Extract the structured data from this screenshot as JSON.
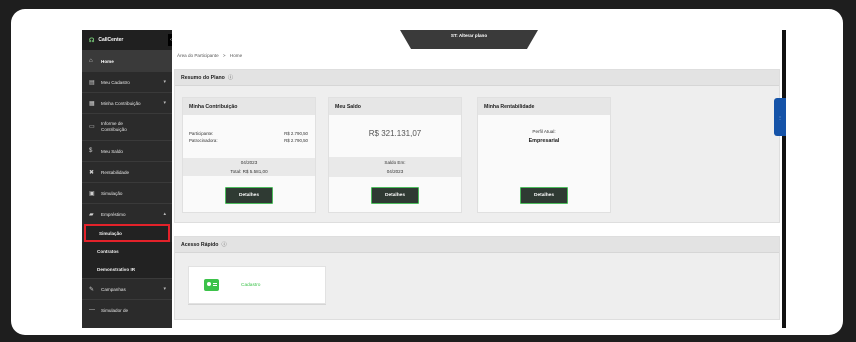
{
  "sidebar": {
    "brand": "CallCenter",
    "items": [
      {
        "label": "Home",
        "icon": "home-icon",
        "glyph": "⌂"
      },
      {
        "label": "Meu Cadastro",
        "icon": "id-card-icon",
        "glyph": "▤"
      },
      {
        "label": "Minha Contribuição",
        "icon": "chart-icon",
        "glyph": "▦"
      },
      {
        "label": "Informe de Contribuição",
        "icon": "document-icon",
        "glyph": "▭"
      },
      {
        "label": "Meu Saldo",
        "icon": "dollar-icon",
        "glyph": "$"
      },
      {
        "label": "Rentabilidade",
        "icon": "percent-icon",
        "glyph": "✖"
      },
      {
        "label": "Simulação",
        "icon": "calculator-icon",
        "glyph": "▣"
      },
      {
        "label": "Empréstimo",
        "icon": "wallet-icon",
        "glyph": "▰"
      }
    ],
    "sub_items": [
      "Simulação",
      "Contratos",
      "Demonstrativo IR"
    ],
    "bottom_items": [
      {
        "label": "Campanhas",
        "icon": "edit-icon",
        "glyph": "✎"
      },
      {
        "label": "Simulador de",
        "icon": "dots-icon",
        "glyph": "—"
      }
    ]
  },
  "topband": {
    "label": "ST: Alterar plano"
  },
  "breadcrumb": {
    "root": "Área do Participante",
    "sep": ">",
    "current": "Home"
  },
  "resumo": {
    "title": "Resumo do Plano",
    "help": "?",
    "contribuicao": {
      "title": "Minha Contribuição",
      "rows": [
        {
          "label": "Participante:",
          "value": "R$ 2.790,50"
        },
        {
          "label": "Patrocinadora:",
          "value": "R$ 2.790,50"
        }
      ],
      "period": "04/2023",
      "total": "Total: R$ 5.581,00",
      "button": "Detalhes"
    },
    "saldo": {
      "title": "Meu Saldo",
      "amount": "R$ 321.131,07",
      "caption": "Saldo Em:",
      "period": "04/2023",
      "button": "Detalhes"
    },
    "rentabilidade": {
      "title": "Minha Rentabilidade",
      "caption": "Perfil Atual:",
      "profile": "Empresarial",
      "button": "Detalhes"
    }
  },
  "acesso": {
    "title": "Acesso Rápido",
    "help": "?",
    "items": [
      {
        "label": "Cadastro",
        "icon": "id-card-icon"
      }
    ]
  },
  "colors": {
    "accent_green": "#3cc24a",
    "sidebar_bg": "#2b2b2b",
    "highlight_red": "#e3222a",
    "right_tab_blue": "#1553a8"
  }
}
